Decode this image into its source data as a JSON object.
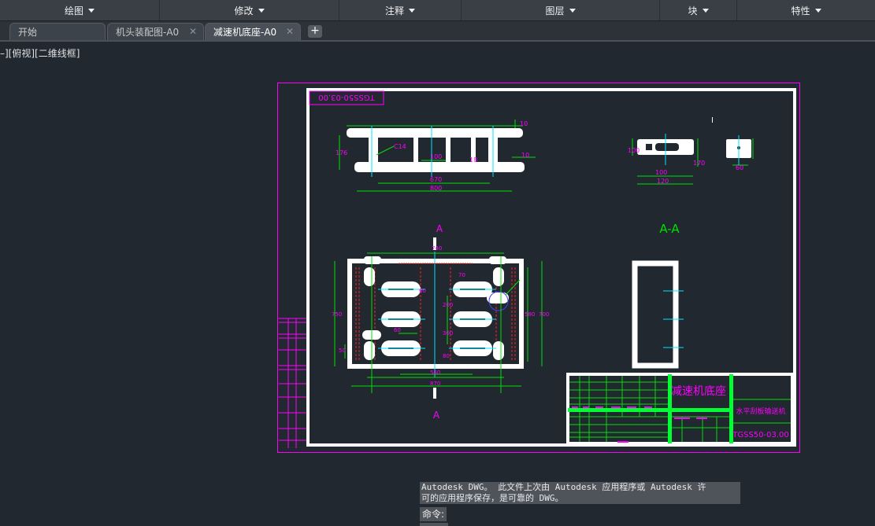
{
  "ribbon": {
    "panels": [
      {
        "label": "绘图"
      },
      {
        "label": "修改"
      },
      {
        "label": "注释"
      },
      {
        "label": "图层"
      },
      {
        "label": "块"
      },
      {
        "label": "特性"
      }
    ]
  },
  "tabs": [
    {
      "label": "开始",
      "closable": false
    },
    {
      "label": "机头装配图-A0",
      "closable": true
    },
    {
      "label": "减速机底座-A0",
      "closable": true,
      "active": true
    }
  ],
  "tab_add": "+",
  "tab_close_glyph": "✕",
  "viewport_label": "–][俯视][二维线框]",
  "drawing": {
    "rotated_code": "TGSS50-03.00",
    "section_label_top": "A",
    "section_label_bottom": "A",
    "section_view_label": "A-A",
    "title_name": "减速机底座",
    "title_project": "水平刮板输送机",
    "title_code": "TGSS50-03.00",
    "cursor_glyph": "I",
    "dims_front": {
      "d1": "C14",
      "d2": "100",
      "d3": "670",
      "d4": "800",
      "d5": "10",
      "d6": "176",
      "d7": "10",
      "d8": "18"
    },
    "dims_side": {
      "d1": "100",
      "d2": "120",
      "d3": "60",
      "d4": "100",
      "d5": "170"
    },
    "dims_plan": {
      "d1": "740",
      "d2": "560",
      "d3": "870",
      "d4": "750",
      "d5": "700",
      "d6": "580",
      "d7": "200",
      "d8": "300",
      "d9": "60",
      "d10": "70",
      "d11": "50",
      "d12": "80",
      "d13": "60"
    },
    "colors": {
      "geometry": "#ffffff",
      "dimension": "#00e000",
      "center": "#00e5ff",
      "border": "#ff00ff",
      "hidden": "#ff2020",
      "title_green": "#00ff33"
    }
  },
  "command": {
    "history_line1": "Autodesk DWG。  此文件上次由 Autodesk 应用程序或 Autodesk 许",
    "history_line2": "可的应用程序保存，是可靠的 DWG。",
    "prompt": "命令:"
  }
}
